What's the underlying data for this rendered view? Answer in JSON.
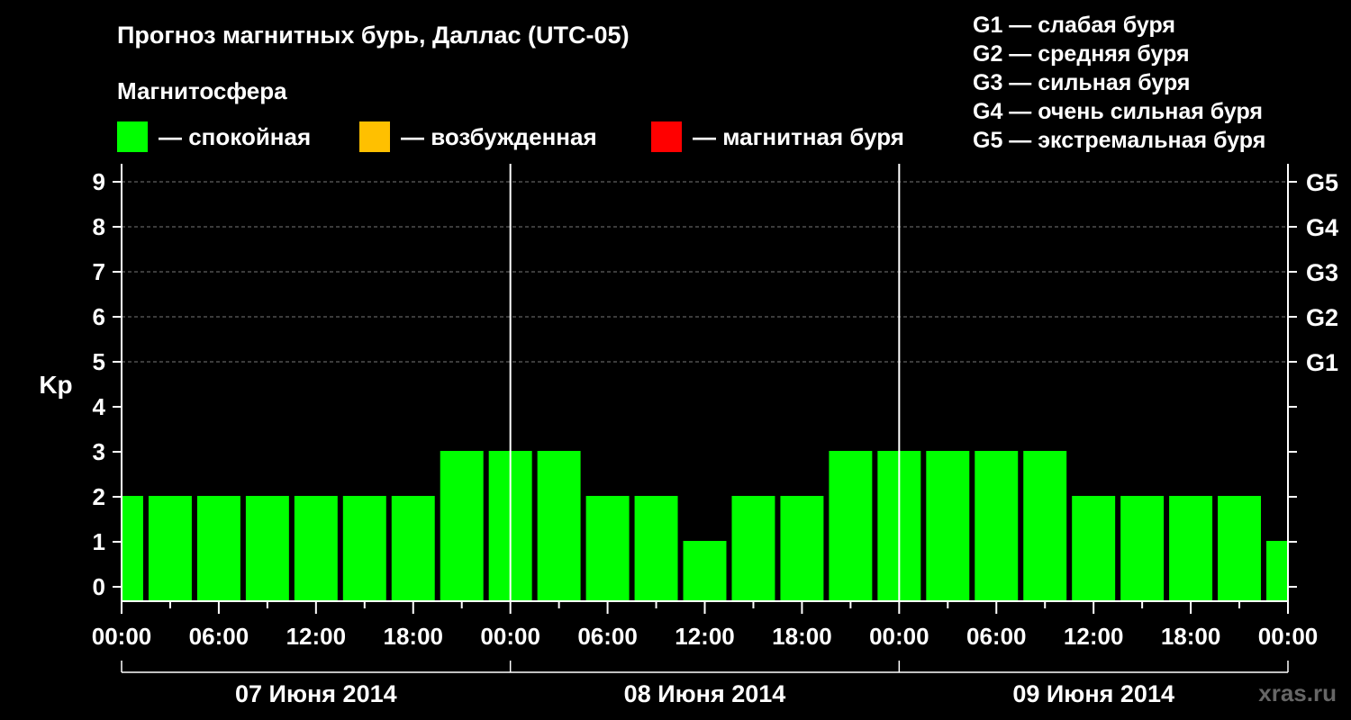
{
  "header": {
    "title": "Прогноз магнитных бурь, Даллас (UTC-05)",
    "subtitle": "Магнитосфера"
  },
  "legend": [
    {
      "label": "— спокойная",
      "color": "#00ff00"
    },
    {
      "label": "— возбужденная",
      "color": "#ffc000"
    },
    {
      "label": "— магнитная буря",
      "color": "#ff0000"
    }
  ],
  "g_legend": [
    "G1 — слабая буря",
    "G2 — средняя буря",
    "G3 — сильная буря",
    "G4 — очень сильная буря",
    "G5 — экстремальная буря"
  ],
  "watermark": "xras.ru",
  "chart_data": {
    "type": "bar",
    "ylabel": "Kp",
    "ylim": [
      0,
      9
    ],
    "y_ticks": [
      "0",
      "1",
      "2",
      "3",
      "4",
      "5",
      "6",
      "7",
      "8",
      "9"
    ],
    "right_ticks": [
      {
        "kp": 5,
        "label": "G1"
      },
      {
        "kp": 6,
        "label": "G2"
      },
      {
        "kp": 7,
        "label": "G3"
      },
      {
        "kp": 8,
        "label": "G4"
      },
      {
        "kp": 9,
        "label": "G5"
      }
    ],
    "x_tick_labels": [
      "00:00",
      "06:00",
      "12:00",
      "18:00",
      "00:00",
      "06:00",
      "12:00",
      "18:00",
      "00:00",
      "06:00",
      "12:00",
      "18:00",
      "00:00"
    ],
    "days": [
      "07 Июня 2014",
      "08 Июня 2014",
      "09 Июня 2014"
    ],
    "interval_hours": 3,
    "values": [
      2,
      2,
      2,
      2,
      2,
      2,
      2,
      3,
      3,
      3,
      2,
      2,
      1,
      2,
      2,
      3,
      3,
      3,
      3,
      3,
      2,
      2,
      2,
      2,
      1
    ],
    "bar_color": "#00ff00",
    "grid": true
  }
}
